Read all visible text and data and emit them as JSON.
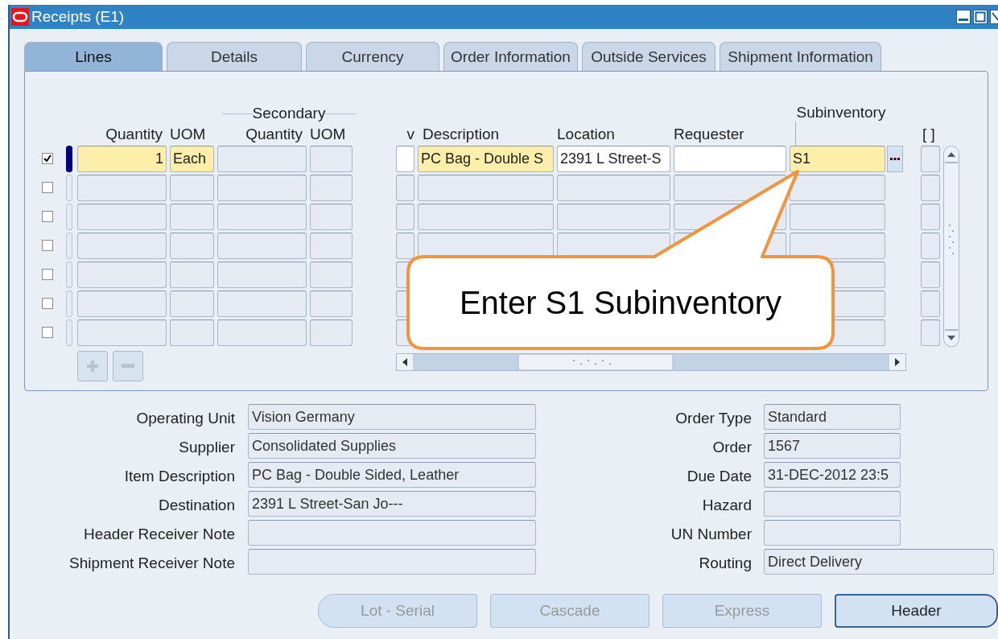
{
  "window": {
    "title": "Receipts (E1)"
  },
  "tabs": [
    {
      "label": "Lines",
      "selected": true
    },
    {
      "label": "Details",
      "selected": false
    },
    {
      "label": "Currency",
      "selected": false
    },
    {
      "label": "Order Information",
      "selected": false
    },
    {
      "label": "Outside Services",
      "selected": false
    },
    {
      "label": "Shipment Information",
      "selected": false
    }
  ],
  "lines": {
    "column_group": "Secondary",
    "columns": [
      "Quantity",
      "UOM",
      "Quantity",
      "UOM",
      "v",
      "Description",
      "Location",
      "Requester",
      "Subinventory",
      "[ ]"
    ],
    "rows": [
      {
        "checked": true,
        "current": true,
        "lov": true,
        "cells": [
          {
            "value": "1",
            "kind": "required"
          },
          {
            "value": "Each",
            "kind": "required"
          },
          {
            "kind": "readonly"
          },
          {
            "kind": "readonly"
          },
          {
            "kind": "editable"
          },
          {
            "value": "PC Bag - Double S",
            "kind": "required"
          },
          {
            "value": "2391 L Street-S",
            "kind": "editable"
          },
          {
            "kind": "editable"
          },
          {
            "value": "S1",
            "kind": "required"
          },
          {
            "kind": "readonly"
          }
        ]
      },
      {
        "checked": false,
        "current": false
      },
      {
        "checked": false,
        "current": false
      },
      {
        "checked": false,
        "current": false
      },
      {
        "checked": false,
        "current": false
      },
      {
        "checked": false,
        "current": false
      },
      {
        "checked": false,
        "current": false
      }
    ]
  },
  "callout": {
    "text": "Enter S1 Subinventory"
  },
  "fields_left": [
    {
      "label": "Operating Unit",
      "value": "Vision Germany"
    },
    {
      "label": "Supplier",
      "value": "Consolidated Supplies"
    },
    {
      "label": "Item Description",
      "value": "PC Bag - Double Sided, Leather"
    },
    {
      "label": "Destination",
      "value": "2391 L Street-San Jo---"
    },
    {
      "label": "Header Receiver Note"
    },
    {
      "label": "Shipment Receiver Note"
    }
  ],
  "fields_right": [
    {
      "label": "Order Type",
      "value": "Standard"
    },
    {
      "label": "Order",
      "value": "1567"
    },
    {
      "label": "Due Date",
      "value": "31-DEC-2012 23:5"
    },
    {
      "label": "Hazard"
    },
    {
      "label": "UN Number"
    },
    {
      "label": "Routing",
      "value": "Direct Delivery"
    }
  ],
  "buttons": [
    {
      "label": "Lot - Serial",
      "disabled": true
    },
    {
      "label": "Cascade",
      "disabled": true
    },
    {
      "label": "Express",
      "disabled": true
    },
    {
      "label": "Header",
      "disabled": false
    }
  ]
}
